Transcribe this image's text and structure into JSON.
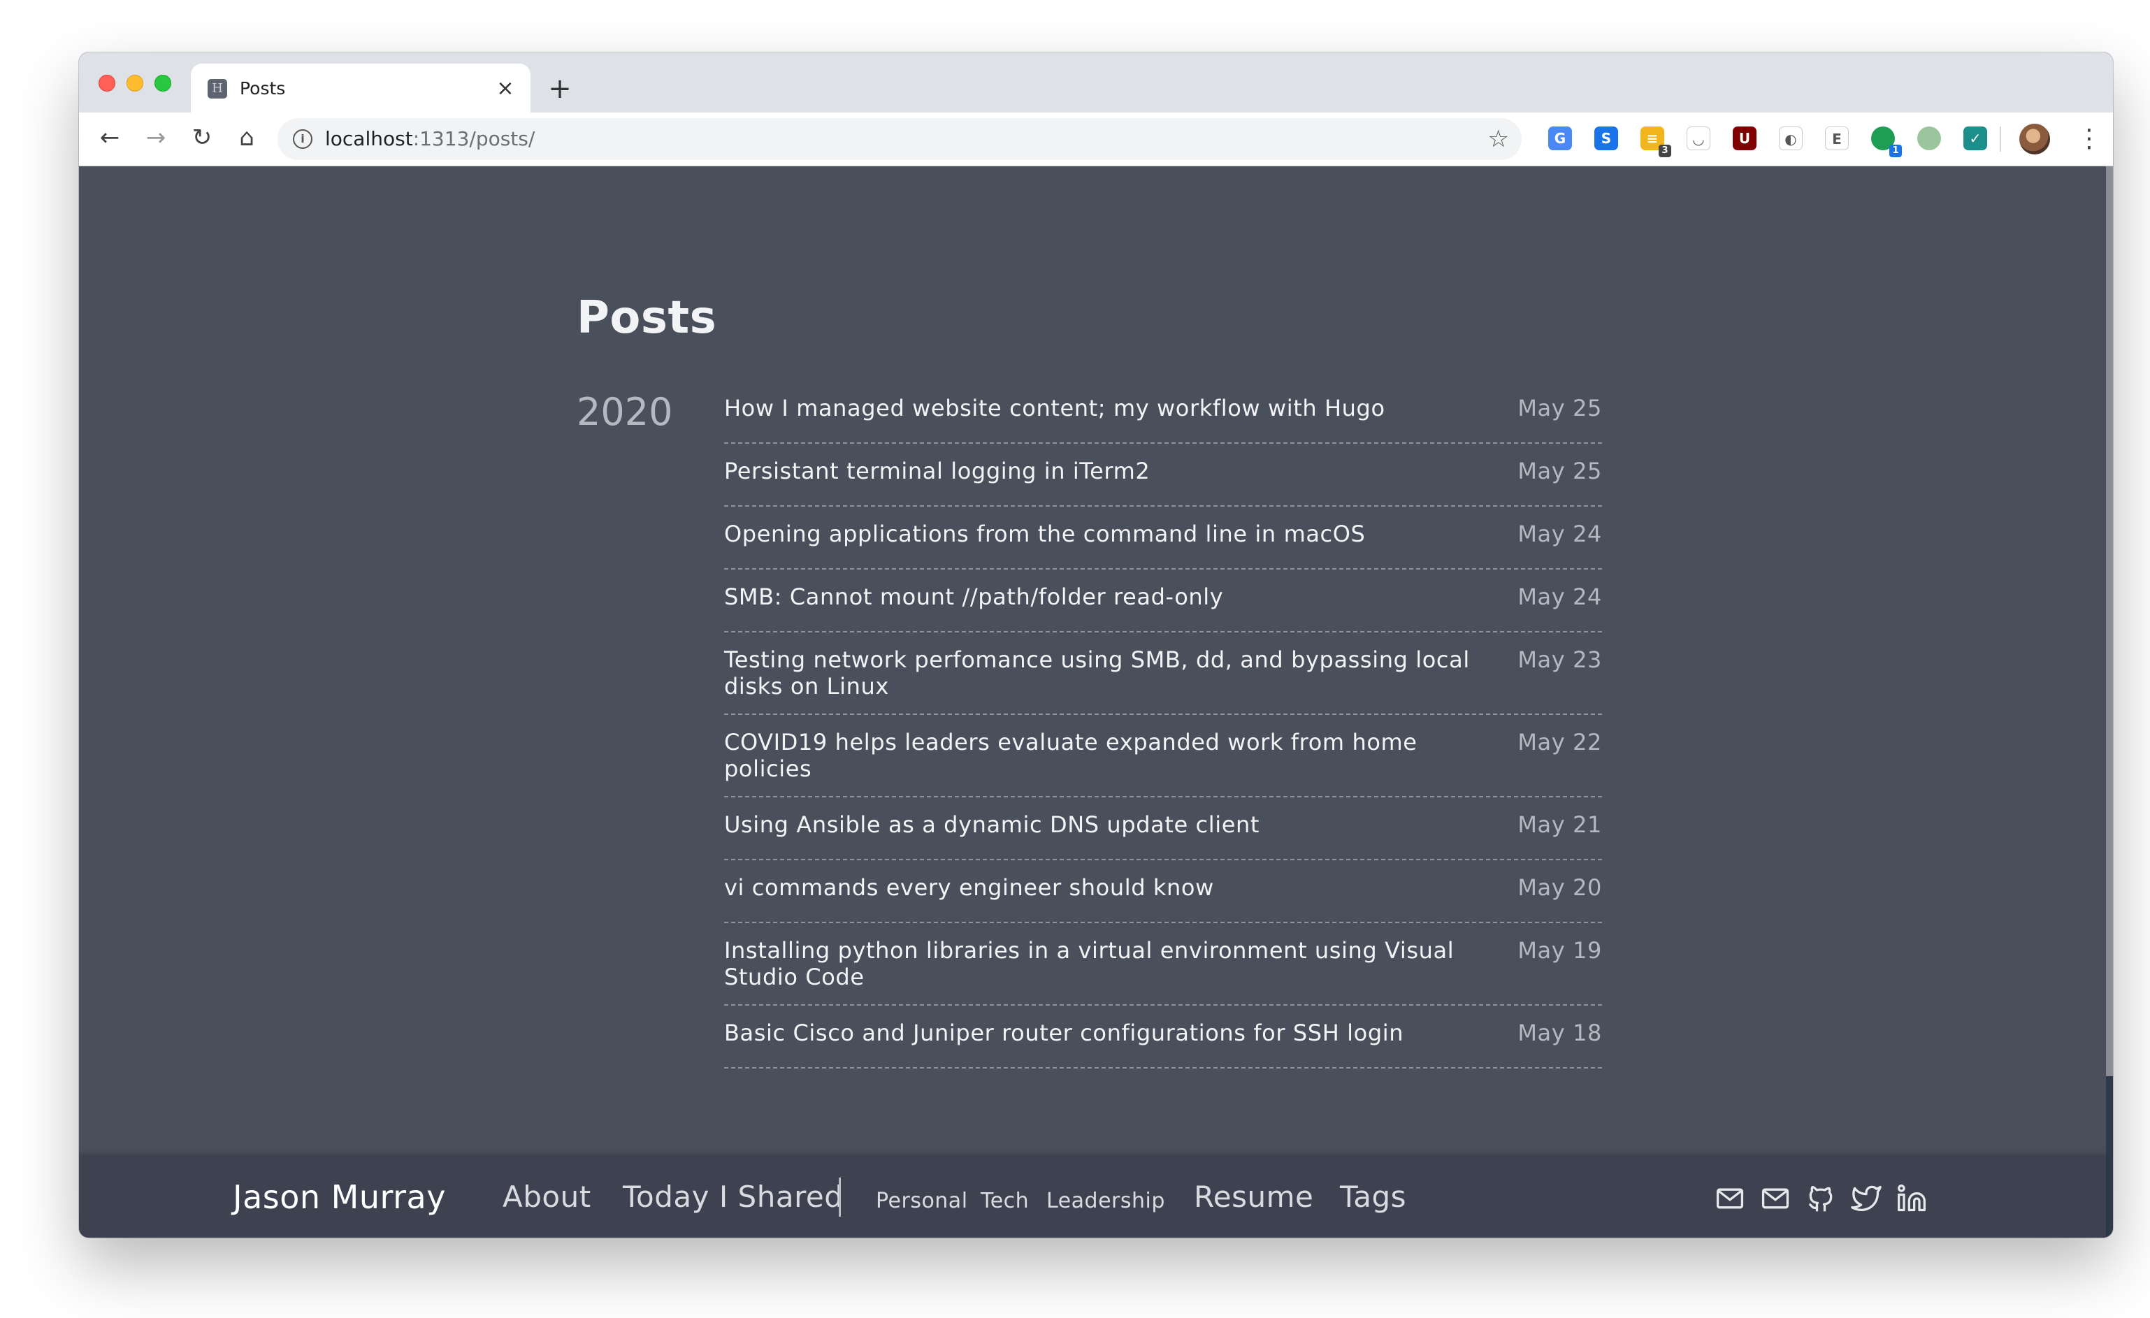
{
  "browser": {
    "tab_title": "Posts",
    "tab_favicon_letter": "H",
    "tab_close": "×",
    "new_tab": "+",
    "url_host": "localhost",
    "url_path": ":1313/posts/",
    "extensions": [
      {
        "name": "google-translate-extension",
        "color": "#4a89f3",
        "glyph": "G"
      },
      {
        "name": "s-extension",
        "color": "#1a73e8",
        "glyph": "S"
      },
      {
        "name": "yellow-extension",
        "color": "#f2b51c",
        "glyph": "≡",
        "badge": "3",
        "badge_color": "#444"
      },
      {
        "name": "pocket-extension",
        "color": "#ffffff",
        "glyph": "◡"
      },
      {
        "name": "ublock-extension",
        "color": "#800000",
        "glyph": "U"
      },
      {
        "name": "circle-extension",
        "color": "#ffffff",
        "glyph": "◐"
      },
      {
        "name": "evernote-extension",
        "color": "#ffffff",
        "glyph": "E"
      },
      {
        "name": "green-dot-extension",
        "color": "#1f9d55",
        "glyph": "",
        "badge": "1",
        "badge_color": "#1a73e8"
      },
      {
        "name": "grey-dot-extension",
        "color": "#9bc59d",
        "glyph": ""
      },
      {
        "name": "teal-extension",
        "color": "#1d8f8a",
        "glyph": "✓"
      }
    ]
  },
  "page": {
    "title": "Posts",
    "year": "2020",
    "posts": [
      {
        "title": "How I managed website content; my workflow with Hugo",
        "date": "May 25"
      },
      {
        "title": "Persistant terminal logging in iTerm2",
        "date": "May 25"
      },
      {
        "title": "Opening applications from the command line in macOS",
        "date": "May 24"
      },
      {
        "title": "SMB: Cannot mount //path/folder read-only",
        "date": "May 24"
      },
      {
        "title": "Testing network perfomance using SMB, dd, and bypassing local disks on Linux",
        "date": "May 23"
      },
      {
        "title": "COVID19 helps leaders evaluate expanded work from home policies",
        "date": "May 22"
      },
      {
        "title": "Using Ansible as a dynamic DNS update client",
        "date": "May 21"
      },
      {
        "title": "vi commands every engineer should know",
        "date": "May 20"
      },
      {
        "title": "Installing python libraries in a virtual environment using Visual Studio Code",
        "date": "May 19"
      },
      {
        "title": "Basic Cisco and Juniper router configurations for SSH login",
        "date": "May 18"
      }
    ]
  },
  "footer": {
    "brand": "Jason Murray",
    "about": "About",
    "today_i_shared": "Today I Shared",
    "personal": "Personal",
    "tech": "Tech",
    "leadership": "Leadership",
    "resume": "Resume",
    "tags": "Tags",
    "icons": [
      "mail-icon",
      "mail-icon",
      "github-icon",
      "twitter-icon",
      "linkedin-icon"
    ]
  }
}
